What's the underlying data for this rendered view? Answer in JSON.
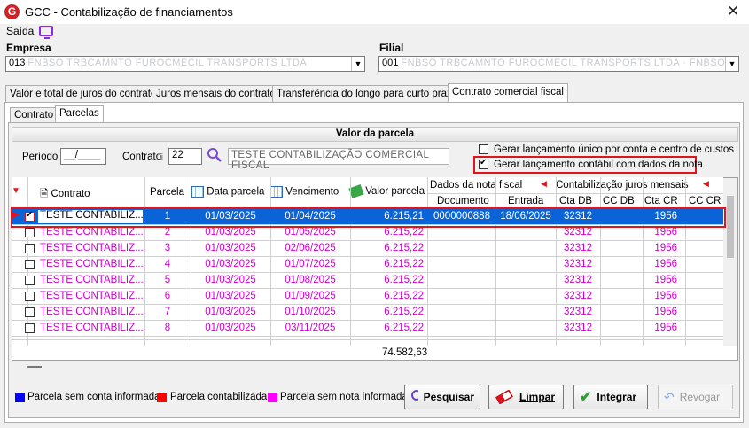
{
  "window": {
    "title": "GCC - Contabilização de financiamentos",
    "logo_letter": "G"
  },
  "menu": {
    "saida": "Saída"
  },
  "empresa": {
    "label": "Empresa",
    "value_code": "013",
    "value_name": "FNBSO TRBCAMNTO FUROCMECIL TRANSPORTS LTDA"
  },
  "filial": {
    "label": "Filial",
    "value_code": "001",
    "value_name": "FNBSO TRBCAMNTO FUROCMECIL TRANSPORTS LTDA · FNBSO NIA"
  },
  "tabs": [
    "Valor e total de juros do contrato",
    "Juros mensais do contrato",
    "Transferência do longo para curto prazo",
    "Contrato comercial fiscal"
  ],
  "subtabs": [
    "Contrato",
    "Parcelas"
  ],
  "section_title": "Valor da parcela",
  "filters": {
    "periodo_label": "Período",
    "periodo_value": "__/____",
    "contrato_label": "Contrato",
    "contrato_value": "22",
    "contrato_desc": "TESTE CONTABILIZAÇÃO COMERCIAL FISCAL",
    "check1_label": "Gerar lançamento único por conta e centro de custos",
    "check2_label": "Gerar lançamento contábil com dados da nota"
  },
  "columns": {
    "contrato": "Contrato",
    "parcela": "Parcela",
    "data_parcela": "Data parcela",
    "vencimento": "Vencimento",
    "valor_parcela": "Valor parcela",
    "dados_nota": "Dados da nota fiscal",
    "documento": "Documento",
    "entrada": "Entrada",
    "contab_juros": "Contabilização juros mensais",
    "cta_db": "Cta DB",
    "cc_db": "CC DB",
    "cta_cr": "Cta CR",
    "cc_cr": "CC CR"
  },
  "rows": [
    {
      "contrato": "TESTE CONTABILIZ...",
      "parcela": "1",
      "data": "01/03/2025",
      "venc": "01/04/2025",
      "valor": "6.215,21",
      "doc": "0000000888",
      "entrada": "18/06/2025",
      "cta_db": "32312",
      "cta_cr": "1956"
    },
    {
      "contrato": "TESTE CONTABILIZ...",
      "parcela": "2",
      "data": "01/03/2025",
      "venc": "01/05/2025",
      "valor": "6.215,22",
      "doc": "",
      "entrada": "",
      "cta_db": "32312",
      "cta_cr": "1956"
    },
    {
      "contrato": "TESTE CONTABILIZ...",
      "parcela": "3",
      "data": "01/03/2025",
      "venc": "02/06/2025",
      "valor": "6.215,22",
      "doc": "",
      "entrada": "",
      "cta_db": "32312",
      "cta_cr": "1956"
    },
    {
      "contrato": "TESTE CONTABILIZ...",
      "parcela": "4",
      "data": "01/03/2025",
      "venc": "01/07/2025",
      "valor": "6.215,22",
      "doc": "",
      "entrada": "",
      "cta_db": "32312",
      "cta_cr": "1956"
    },
    {
      "contrato": "TESTE CONTABILIZ...",
      "parcela": "5",
      "data": "01/03/2025",
      "venc": "01/08/2025",
      "valor": "6.215,22",
      "doc": "",
      "entrada": "",
      "cta_db": "32312",
      "cta_cr": "1956"
    },
    {
      "contrato": "TESTE CONTABILIZ...",
      "parcela": "6",
      "data": "01/03/2025",
      "venc": "01/09/2025",
      "valor": "6.215,22",
      "doc": "",
      "entrada": "",
      "cta_db": "32312",
      "cta_cr": "1956"
    },
    {
      "contrato": "TESTE CONTABILIZ...",
      "parcela": "7",
      "data": "01/03/2025",
      "venc": "01/10/2025",
      "valor": "6.215,22",
      "doc": "",
      "entrada": "",
      "cta_db": "32312",
      "cta_cr": "1956"
    },
    {
      "contrato": "TESTE CONTABILIZ...",
      "parcela": "8",
      "data": "01/03/2025",
      "venc": "03/11/2025",
      "valor": "6.215,22",
      "doc": "",
      "entrada": "",
      "cta_db": "32312",
      "cta_cr": "1956"
    }
  ],
  "total": "74.582,63",
  "legend": [
    {
      "label": "Parcela sem conta informada",
      "color": "#0000ff"
    },
    {
      "label": "Parcela contabilizada",
      "color": "#ff0000"
    },
    {
      "label": "Parcela sem nota informada",
      "color": "#ff00ff"
    }
  ],
  "buttons": {
    "pesquisar": "Pesquisar",
    "limpar": "Limpar",
    "integrar": "Integrar",
    "revogar": "Revogar"
  },
  "colors": {
    "selected_row": "#0a64d8",
    "pending_text": "#cc00cc",
    "highlight_box": "#e0141c"
  }
}
